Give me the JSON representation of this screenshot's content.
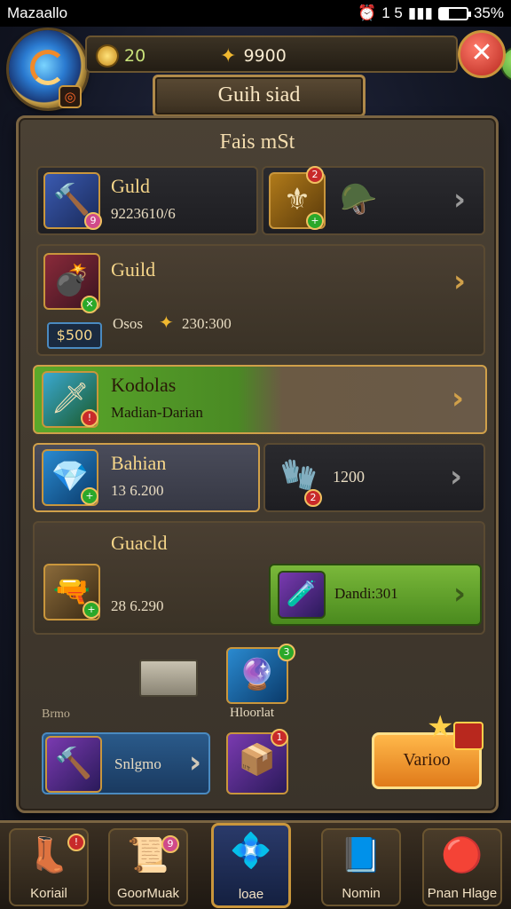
{
  "status": {
    "carrier": "Mazaallo",
    "time_text": "1 5",
    "battery": "35%"
  },
  "header": {
    "gems": "20",
    "gold": "9900",
    "title": "Guih siad"
  },
  "panel": {
    "title": "Fais mSt"
  },
  "rows": {
    "row1": {
      "name": "Guld",
      "value": "9223610/6"
    },
    "row2": {
      "name": "Guild",
      "tag": "$500",
      "desc": "Osos",
      "cost": "230:300"
    },
    "row3": {
      "name": "Kodolas",
      "sub": "Madian-Darian"
    },
    "row4": {
      "name": "Bahian",
      "value": "13 6.200",
      "right_value": "1200"
    },
    "row5": {
      "name": "Guacld",
      "value": "28 6.290",
      "button_label": "Dandi:301"
    }
  },
  "bottom_section": {
    "small_label": "Brmo",
    "item_label": "Hloorlat",
    "blue_button_label": "Snlgmo",
    "orange_button_label": "Varioo"
  },
  "nav": [
    {
      "label": "Koriail"
    },
    {
      "label": "GoorMuak"
    },
    {
      "label": "loae"
    },
    {
      "label": "Nomin"
    },
    {
      "label": "Pnan Hlage"
    }
  ],
  "colors": {
    "accent_gold": "#c9963c",
    "green": "#5aa82a",
    "close_red": "#b8281e"
  }
}
